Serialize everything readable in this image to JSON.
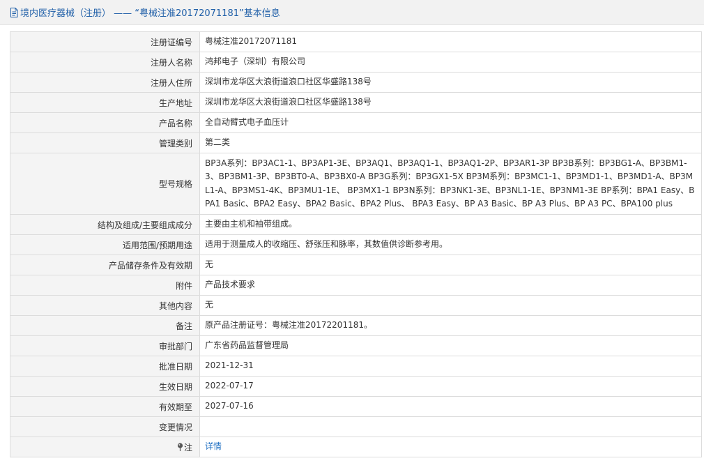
{
  "header": {
    "title": "境内医疗器械（注册） —— “粤械注准20172071181”基本信息"
  },
  "rows": [
    {
      "label": "注册证编号",
      "value": "粤械注准20172071181"
    },
    {
      "label": "注册人名称",
      "value": "鸿邦电子（深圳）有限公司"
    },
    {
      "label": "注册人住所",
      "value": "深圳市龙华区大浪街道浪口社区华盛路138号"
    },
    {
      "label": "生产地址",
      "value": "深圳市龙华区大浪街道浪口社区华盛路138号"
    },
    {
      "label": "产品名称",
      "value": "全自动臂式电子血压计"
    },
    {
      "label": "管理类别",
      "value": "第二类"
    },
    {
      "label": "型号规格",
      "value": "BP3A系列：BP3AC1-1、BP3AP1-3E、BP3AQ1、BP3AQ1-1、BP3AQ1-2P、BP3AR1-3P BP3B系列：BP3BG1-A、BP3BM1-3、BP3BM1-3P、BP3BT0-A、BP3BX0-A BP3G系列：BP3GX1-5X BP3M系列：BP3MC1-1、BP3MD1-1、BP3MD1-A、BP3ML1-A、BP3MS1-4K、BP3MU1-1E、 BP3MX1-1 BP3N系列：BP3NK1-3E、BP3NL1-1E、BP3NM1-3E BP系列：BPA1 Easy、BPA1 Basic、BPA2 Easy、BPA2 Basic、BPA2 Plus、 BPA3 Easy、BP A3 Basic、BP A3 Plus、BP A3 PC、BPA100 plus"
    },
    {
      "label": "结构及组成/主要组成成分",
      "value": "主要由主机和袖带组成。"
    },
    {
      "label": "适用范围/预期用途",
      "value": "适用于测量成人的收缩压、舒张压和脉率，其数值供诊断参考用。"
    },
    {
      "label": "产品储存条件及有效期",
      "value": "无"
    },
    {
      "label": "附件",
      "value": "产品技术要求"
    },
    {
      "label": "其他内容",
      "value": "无"
    },
    {
      "label": "备注",
      "value": "原产品注册证号：粤械注准20172201181。"
    },
    {
      "label": "审批部门",
      "value": "广东省药品监督管理局"
    },
    {
      "label": "批准日期",
      "value": "2021-12-31"
    },
    {
      "label": "生效日期",
      "value": "2022-07-17"
    },
    {
      "label": "有效期至",
      "value": "2027-07-16"
    },
    {
      "label": "变更情况",
      "value": ""
    },
    {
      "label": "注",
      "value": "详情",
      "icon": "pin-icon"
    }
  ]
}
